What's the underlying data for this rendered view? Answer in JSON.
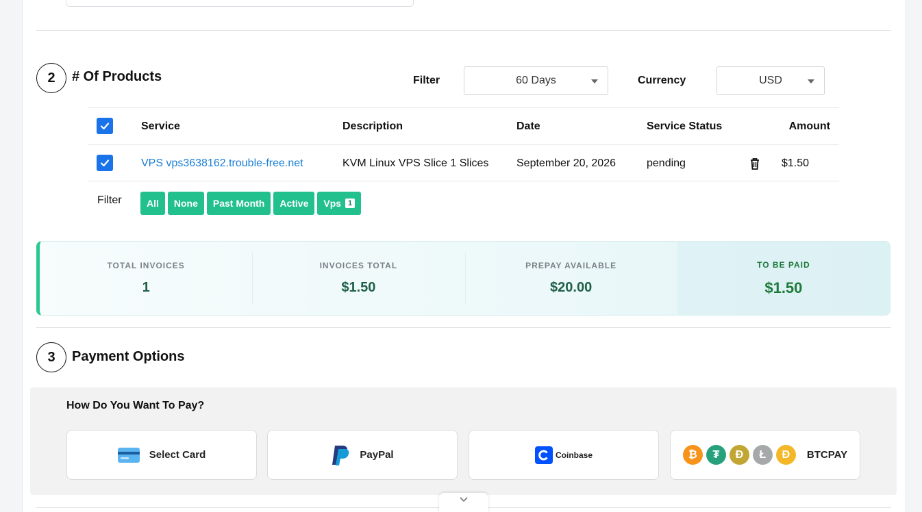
{
  "products": {
    "step": "2",
    "title": "# Of Products",
    "filter_label": "Filter",
    "filter_value": "60 Days",
    "currency_label": "Currency",
    "currency_value": "USD",
    "columns": [
      "Service",
      "Description",
      "Date",
      "Service Status",
      "Amount"
    ],
    "rows": [
      {
        "service": "VPS vps3638162.trouble-free.net",
        "description": "KVM Linux VPS Slice 1 Slices",
        "date": "September 20, 2026",
        "status": "pending",
        "amount": "$1.50"
      }
    ],
    "row_filter_label": "Filter",
    "chips": [
      {
        "label": "All"
      },
      {
        "label": "None"
      },
      {
        "label": "Past Month"
      },
      {
        "label": "Active"
      },
      {
        "label": "Vps",
        "count": "1"
      }
    ]
  },
  "summary": [
    {
      "label": "TOTAL INVOICES",
      "value": "1"
    },
    {
      "label": "INVOICES TOTAL",
      "value": "$1.50"
    },
    {
      "label": "PREPAY AVAILABLE",
      "value": "$20.00"
    },
    {
      "label": "TO BE PAID",
      "value": "$1.50"
    }
  ],
  "payment": {
    "step": "3",
    "title": "Payment Options",
    "question": "How Do You Want To Pay?",
    "options": [
      {
        "label": "Select Card",
        "icon": "credit-card-icon"
      },
      {
        "label": "PayPal",
        "icon": "paypal-icon"
      },
      {
        "label": "Coinbase",
        "icon": "coinbase-icon"
      },
      {
        "label": "BTCPAY",
        "icon": "crypto-coins-icon"
      }
    ]
  },
  "colors": {
    "accent_green": "#22c08c",
    "link_blue": "#1a7fd6",
    "checkbox_blue": "#1a73e8",
    "stat_value": "#1f5f48"
  }
}
